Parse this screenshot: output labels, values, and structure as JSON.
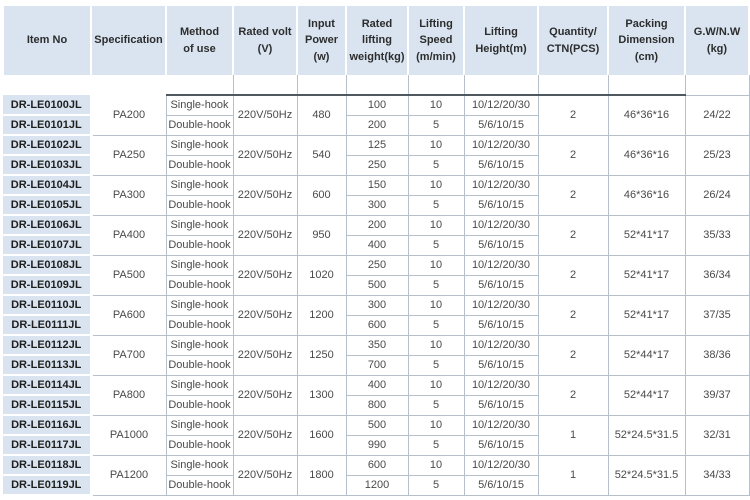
{
  "colors": {
    "header_bg": "#d9e4f0",
    "item_col_bg": "#d9e4f0",
    "grid_border": "#b6c0ca",
    "accent_top_border": "#50585f",
    "header_text": "#2d2d2d",
    "body_text": "#4a4a4a",
    "item_text": "#1f1f1f"
  },
  "table": {
    "headers": [
      "Item No",
      "Specification",
      "Method\nof use",
      "Rated volt\n(V)",
      "Input\nPower\n(w)",
      "Rated\nlifting\nweight(kg)",
      "Lifting\nSpeed\n(m/min)",
      "Lifting\nHeight(m)",
      "Quantity/\nCTN(PCS)",
      "Packing\nDimension\n(cm)",
      "G.W/N.W\n(kg)"
    ],
    "groups": [
      {
        "items": [
          "DR-LE0100JL",
          "DR-LE0101JL"
        ],
        "spec": "PA200",
        "methods": [
          "Single-hook",
          "Double-hook"
        ],
        "volt": "220V/50Hz",
        "power": "480",
        "weights": [
          "100",
          "200"
        ],
        "speeds": [
          "10",
          "5"
        ],
        "heights": [
          "10/12/20/30",
          "5/6/10/15"
        ],
        "qty": "2",
        "packing": "46*36*16",
        "gw_nw": "24/22"
      },
      {
        "items": [
          "DR-LE0102JL",
          "DR-LE0103JL"
        ],
        "spec": "PA250",
        "methods": [
          "Single-hook",
          "Double-hook"
        ],
        "volt": "220V/50Hz",
        "power": "540",
        "weights": [
          "125",
          "250"
        ],
        "speeds": [
          "10",
          "5"
        ],
        "heights": [
          "10/12/20/30",
          "5/6/10/15"
        ],
        "qty": "2",
        "packing": "46*36*16",
        "gw_nw": "25/23"
      },
      {
        "items": [
          "DR-LE0104JL",
          "DR-LE0105JL"
        ],
        "spec": "PA300",
        "methods": [
          "Single-hook",
          "Double-hook"
        ],
        "volt": "220V/50Hz",
        "power": "600",
        "weights": [
          "150",
          "300"
        ],
        "speeds": [
          "10",
          "5"
        ],
        "heights": [
          "10/12/20/30",
          "5/6/10/15"
        ],
        "qty": "2",
        "packing": "46*36*16",
        "gw_nw": "26/24"
      },
      {
        "items": [
          "DR-LE0106JL",
          "DR-LE0107JL"
        ],
        "spec": "PA400",
        "methods": [
          "Single-hook",
          "Double-hook"
        ],
        "volt": "220V/50Hz",
        "power": "950",
        "weights": [
          "200",
          "400"
        ],
        "speeds": [
          "10",
          "5"
        ],
        "heights": [
          "10/12/20/30",
          "5/6/10/15"
        ],
        "qty": "2",
        "packing": "52*41*17",
        "gw_nw": "35/33"
      },
      {
        "items": [
          "DR-LE0108JL",
          "DR-LE0109JL"
        ],
        "spec": "PA500",
        "methods": [
          "Single-hook",
          "Double-hook"
        ],
        "volt": "220V/50Hz",
        "power": "1020",
        "weights": [
          "250",
          "500"
        ],
        "speeds": [
          "10",
          "5"
        ],
        "heights": [
          "10/12/20/30",
          "5/6/10/15"
        ],
        "qty": "2",
        "packing": "52*41*17",
        "gw_nw": "36/34"
      },
      {
        "items": [
          "DR-LE0110JL",
          "DR-LE0111JL"
        ],
        "spec": "PA600",
        "methods": [
          "Single-hook",
          "Double-hook"
        ],
        "volt": "220V/50Hz",
        "power": "1200",
        "weights": [
          "300",
          "600"
        ],
        "speeds": [
          "10",
          "5"
        ],
        "heights": [
          "10/12/20/30",
          "5/6/10/15"
        ],
        "qty": "2",
        "packing": "52*41*17",
        "gw_nw": "37/35"
      },
      {
        "items": [
          "DR-LE0112JL",
          "DR-LE0113JL"
        ],
        "spec": "PA700",
        "methods": [
          "Single-hook",
          "Double-hook"
        ],
        "volt": "220V/50Hz",
        "power": "1250",
        "weights": [
          "350",
          "700"
        ],
        "speeds": [
          "10",
          "5"
        ],
        "heights": [
          "10/12/20/30",
          "5/6/10/15"
        ],
        "qty": "2",
        "packing": "52*44*17",
        "gw_nw": "38/36"
      },
      {
        "items": [
          "DR-LE0114JL",
          "DR-LE0115JL"
        ],
        "spec": "PA800",
        "methods": [
          "Single-hook",
          "Double-hook"
        ],
        "volt": "220V/50Hz",
        "power": "1300",
        "weights": [
          "400",
          "800"
        ],
        "speeds": [
          "10",
          "5"
        ],
        "heights": [
          "10/12/20/30",
          "5/6/10/15"
        ],
        "qty": "2",
        "packing": "52*44*17",
        "gw_nw": "39/37"
      },
      {
        "items": [
          "DR-LE0116JL",
          "DR-LE0117JL"
        ],
        "spec": "PA1000",
        "methods": [
          "Single-hook",
          "Double-hook"
        ],
        "volt": "220V/50Hz",
        "power": "1600",
        "weights": [
          "500",
          "990"
        ],
        "speeds": [
          "10",
          "5"
        ],
        "heights": [
          "10/12/20/30",
          "5/6/10/15"
        ],
        "qty": "1",
        "packing": "52*24.5*31.5",
        "gw_nw": "32/31"
      },
      {
        "items": [
          "DR-LE0118JL",
          "DR-LE0119JL"
        ],
        "spec": "PA1200",
        "methods": [
          "Single-hook",
          "Double-hook"
        ],
        "volt": "220V/50Hz",
        "power": "1800",
        "weights": [
          "600",
          "1200"
        ],
        "speeds": [
          "10",
          "5"
        ],
        "heights": [
          "10/12/20/30",
          "5/6/10/15"
        ],
        "qty": "1",
        "packing": "52*24.5*31.5",
        "gw_nw": "34/33"
      }
    ]
  }
}
